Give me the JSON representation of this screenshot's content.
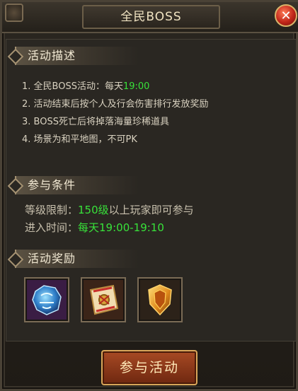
{
  "window": {
    "title": "全民BOSS",
    "close_icon": "close-icon"
  },
  "description": {
    "header": "活动描述",
    "lines": [
      {
        "num": "1.",
        "text": "全民BOSS活动：每天",
        "highlight": "19:00"
      },
      {
        "num": "2.",
        "text": "活动结束后按个人及行会伤害排行发放奖励"
      },
      {
        "num": "3.",
        "text": "BOSS死亡后将掉落海量珍稀道具"
      },
      {
        "num": "4.",
        "text": "场景为和平地图，不可PK"
      }
    ]
  },
  "conditions": {
    "header": "参与条件",
    "level_label": "等级限制：",
    "level_value": "150级",
    "level_suffix": "以上玩家即可参与",
    "time_label": "进入时间：",
    "time_value": "每天19:00-19:10"
  },
  "rewards": {
    "header": "活动奖励",
    "items": [
      {
        "icon": "blue-rune-stone-icon"
      },
      {
        "icon": "scroll-icon"
      },
      {
        "icon": "golden-shield-icon"
      }
    ]
  },
  "actions": {
    "join_label": "参与活动"
  },
  "colors": {
    "highlight_green": "#38e23a",
    "accent_gold": "#d9a65a"
  }
}
